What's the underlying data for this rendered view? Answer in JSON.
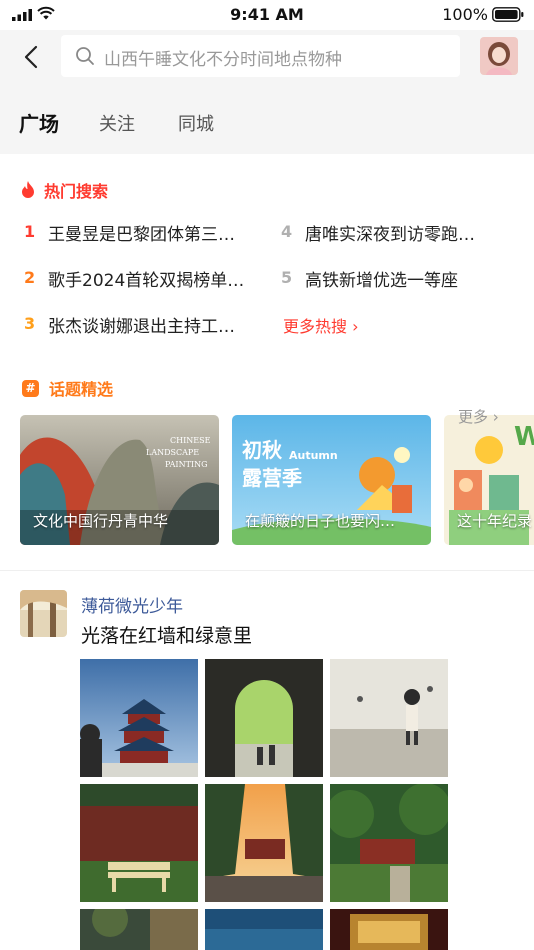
{
  "status_bar": {
    "time": "9:41 AM",
    "battery": "100%"
  },
  "search": {
    "placeholder": "山西午睡文化不分时间地点物种"
  },
  "tabs": [
    {
      "label": "广场",
      "active": true
    },
    {
      "label": "关注",
      "active": false
    },
    {
      "label": "同城",
      "active": false
    }
  ],
  "hot_search": {
    "title": "热门搜索",
    "items": [
      {
        "rank": "1",
        "text": "王曼昱是巴黎团体第三…",
        "color": "#ff3b30"
      },
      {
        "rank": "2",
        "text": "歌手2024首轮双揭榜单…",
        "color": "#ff7a1a"
      },
      {
        "rank": "3",
        "text": "张杰谈谢娜退出主持工…",
        "color": "#ff9f1a"
      },
      {
        "rank": "4",
        "text": "唐唯实深夜到访零跑…",
        "color": "#b0b0b0"
      },
      {
        "rank": "5",
        "text": "高铁新增优选一等座",
        "color": "#b0b0b0"
      }
    ],
    "more_label": "更多热搜 ›"
  },
  "topics": {
    "title": "话题精选",
    "more_label": "更多 ›",
    "cards": [
      {
        "caption": "文化中国行丹青中华",
        "art_text_1": "CHINESE",
        "art_text_2": "LANDSCAPE",
        "art_text_3": "PAINTING"
      },
      {
        "caption": "在颠簸的日子也要闪…",
        "art_text_1": "初秋",
        "art_text_2": "Autumn",
        "art_text_3": "露营季"
      },
      {
        "caption": "这十年纪录",
        "art_text_1": "W"
      }
    ]
  },
  "post": {
    "user": "薄荷微光少年",
    "text": "光落在红墙和绿意里"
  },
  "colors": {
    "accent": "#ff3b30",
    "topic_orange": "#ff7a1a",
    "link_blue": "#3d5a99"
  }
}
